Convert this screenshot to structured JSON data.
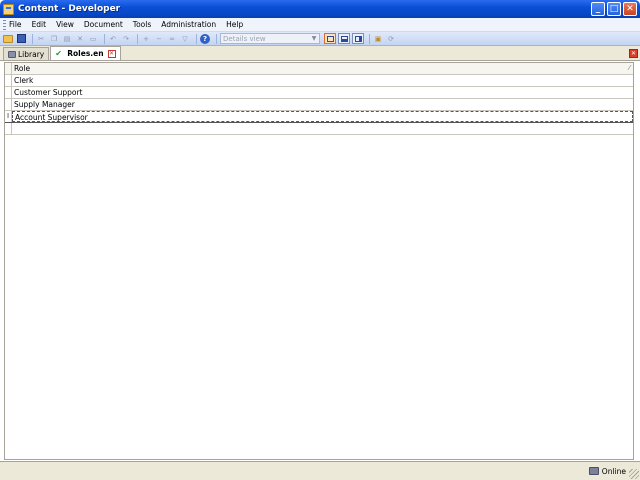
{
  "window": {
    "title": "Content - Developer",
    "controls": {
      "minimize": "_",
      "maximize": "□",
      "close": "✕"
    }
  },
  "menu": {
    "items": [
      {
        "label": "File"
      },
      {
        "label": "Edit"
      },
      {
        "label": "View"
      },
      {
        "label": "Document"
      },
      {
        "label": "Tools"
      },
      {
        "label": "Administration"
      },
      {
        "label": "Help"
      }
    ]
  },
  "toolbar": {
    "view_select": {
      "value": "Details view"
    },
    "icons": [
      "open-folder-icon",
      "save-icon",
      "cut-icon",
      "copy-icon",
      "paste-icon",
      "delete-icon",
      "undo-icon",
      "redo-icon",
      "help-icon",
      "layout-single-icon",
      "layout-split-horizontal-icon",
      "layout-split-vertical-icon",
      "properties-icon",
      "refresh-icon"
    ]
  },
  "tabs": [
    {
      "label": "Library",
      "active": false
    },
    {
      "label": "Roles.en",
      "active": true
    }
  ],
  "grid": {
    "column_header": "Role",
    "sort_glyph": "⁄",
    "edit_marker": "I",
    "rows": [
      {
        "value": "Clerk"
      },
      {
        "value": "Customer Support"
      },
      {
        "value": "Supply Manager"
      },
      {
        "value": "Account Supervisor",
        "editing": true
      },
      {
        "value": ""
      }
    ]
  },
  "status": {
    "connection": "Online"
  },
  "colors": {
    "titlebar": "#0a4fd6",
    "menubar": "#eef3fc",
    "toolbar": "#c3d4f2",
    "chrome": "#ece9d8",
    "close_accent": "#d8402a"
  }
}
